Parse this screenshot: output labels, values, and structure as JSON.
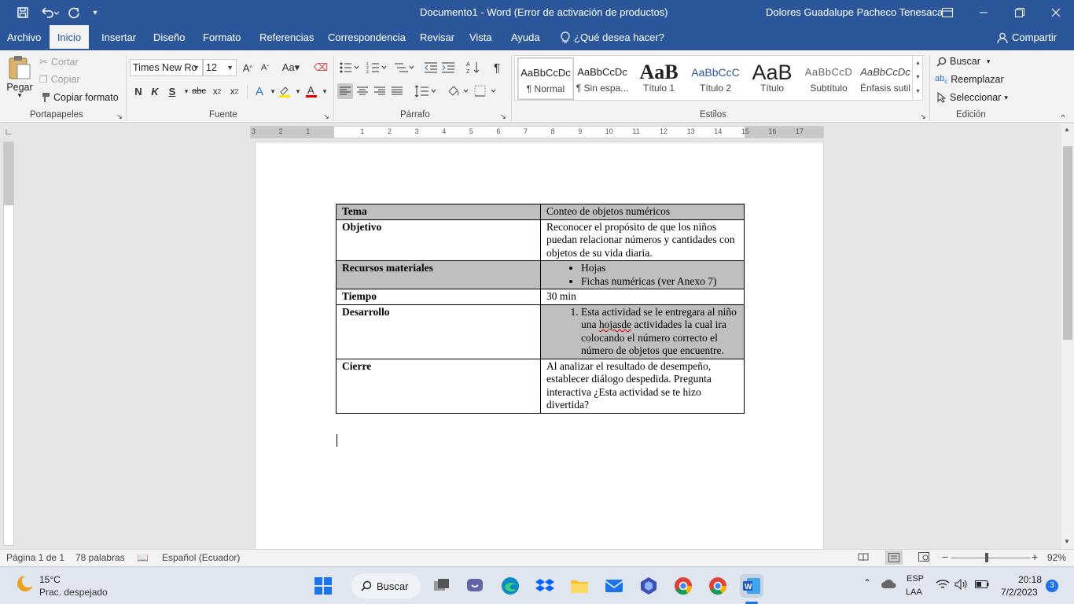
{
  "titlebar": {
    "doc_title": "Documento1  -  Word (Error de activación de productos)",
    "user": "Dolores Guadalupe Pacheco Tenesaca"
  },
  "menu": {
    "tabs": [
      "Archivo",
      "Inicio",
      "Insertar",
      "Diseño",
      "Formato",
      "Referencias",
      "Correspondencia",
      "Revisar",
      "Vista",
      "Ayuda"
    ],
    "active_tab": "Inicio",
    "tell_me": "¿Qué desea hacer?",
    "share": "Compartir"
  },
  "ribbon": {
    "clipboard": {
      "paste": "Pegar",
      "cut": "Cortar",
      "copy": "Copiar",
      "format_painter": "Copiar formato",
      "label": "Portapapeles"
    },
    "font": {
      "font_name": "Times New Ro",
      "font_size": "12",
      "bold": "N",
      "italic": "K",
      "underline": "S",
      "strike": "abc",
      "label": "Fuente"
    },
    "paragraph": {
      "label": "Párrafo"
    },
    "styles": {
      "label": "Estilos",
      "items": [
        {
          "preview": "AaBbCcDc",
          "name": "¶ Normal"
        },
        {
          "preview": "AaBbCcDc",
          "name": "¶ Sin espa..."
        },
        {
          "preview": "AaB",
          "name": "Título 1"
        },
        {
          "preview": "AaBbCcC",
          "name": "Título 2"
        },
        {
          "preview": "AaB",
          "name": "Título"
        },
        {
          "preview": "AaBbCcD",
          "name": "Subtítulo"
        },
        {
          "preview": "AaBbCcDc",
          "name": "Énfasis sutil"
        }
      ]
    },
    "editing": {
      "find": "Buscar",
      "replace": "Reemplazar",
      "select": "Seleccionar",
      "label": "Edición"
    }
  },
  "ruler": {
    "numbers": [
      "3",
      "2",
      "1",
      "1",
      "2",
      "3",
      "4",
      "5",
      "6",
      "7",
      "8",
      "9",
      "10",
      "11",
      "12",
      "13",
      "14",
      "15",
      "16",
      "17"
    ]
  },
  "table": {
    "rows": [
      {
        "label": "Tema",
        "value": "Conteo de objetos numéricos"
      },
      {
        "label": "Objetivo",
        "value": "Reconocer el propósito de que los niños puedan relacionar números y cantidades con objetos de su vida diaria."
      },
      {
        "label": "Recursos materiales",
        "items": [
          "Hojas",
          "Fichas numéricas (ver Anexo 7)"
        ]
      },
      {
        "label": "Tiempo",
        "value": "30 min"
      },
      {
        "label": "Desarrollo",
        "pre": "Esta actividad se le entregara al niño una ",
        "misspelled": "hojasde",
        "post": " actividades la cual ira colocando el número correcto el número de objetos que encuentre."
      },
      {
        "label": "Cierre",
        "value": "Al analizar el resultado de desempeño, establecer diálogo despedida. Pregunta interactiva ¿Esta actividad se te hizo divertida?"
      }
    ]
  },
  "status": {
    "page": "Página 1 de 1",
    "words": "78 palabras",
    "language": "Español (Ecuador)",
    "zoom": "92%"
  },
  "taskbar": {
    "weather_temp": "15°C",
    "weather_desc": "Prac. despejado",
    "search": "Buscar",
    "lang": "ESP",
    "lang2": "LAA",
    "time": "20:18",
    "date": "7/2/2023",
    "notifications": "3"
  }
}
